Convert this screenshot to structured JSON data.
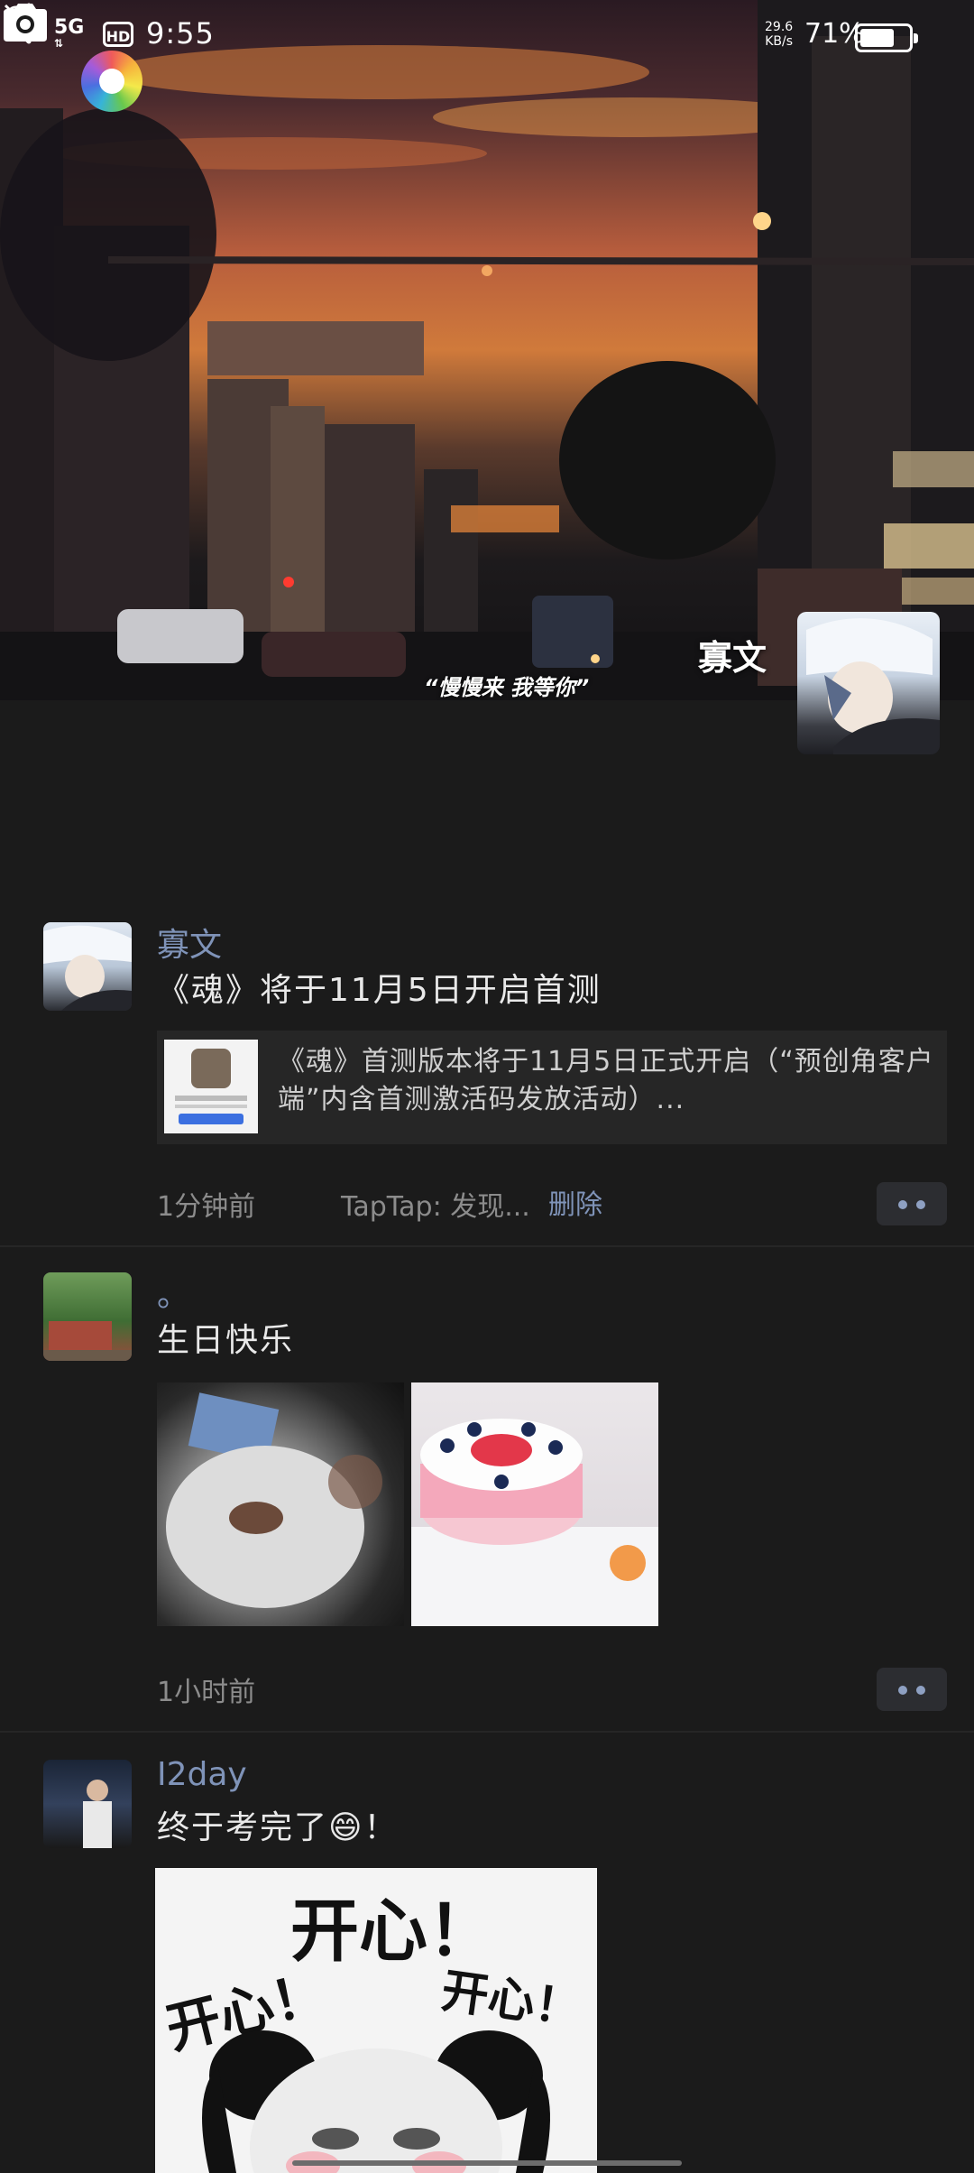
{
  "status_bar": {
    "network": "5G",
    "hd": "HD",
    "time": "9:55",
    "speed_value": "29.6",
    "speed_unit": "KB/s",
    "battery_percent": "71%",
    "battery_level": 0.71
  },
  "cover": {
    "caption": "“慢慢来 我等你”",
    "profile_name": "寡文"
  },
  "icons": {
    "back": "back-icon",
    "camera": "camera-icon",
    "more": "more-icon",
    "app": "app-logo"
  },
  "posts": [
    {
      "author": "寡文",
      "text": "《魂》将于11月5日开启首测",
      "link_text": "《魂》首测版本将于11月5日正式开启（“预创角客户端”内含首测激活码发放活动）...",
      "time": "1分钟前",
      "source": "TapTap: 发现...",
      "delete": "删除"
    },
    {
      "author": "。",
      "text": "生日快乐",
      "time": "1小时前"
    },
    {
      "author": "I2day",
      "text": "终于考完了😄！",
      "image_text": [
        "开心！",
        "开心！",
        "开心！"
      ]
    }
  ],
  "colors": {
    "background": "#1b1b1b",
    "name_blue": "#7f93b8",
    "text": "#e9e9e9",
    "muted": "#8c8c8c"
  }
}
